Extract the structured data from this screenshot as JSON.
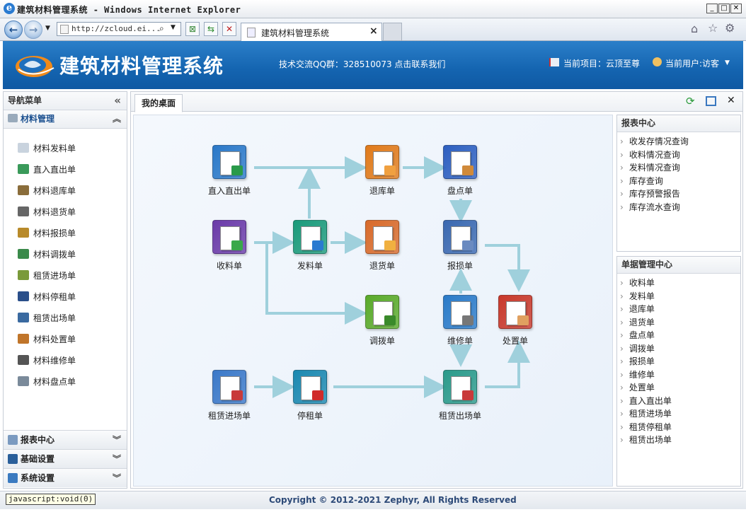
{
  "browser": {
    "window_title": "建筑材料管理系统 - Windows Internet Explorer",
    "address": "http://zcloud.ei...",
    "tab_title": "建筑材料管理系统",
    "status_text": "javascript:void(0)"
  },
  "header": {
    "app_title": "建筑材料管理系统",
    "qq_text": "技术交流QQ群：328510073 点击联系我们",
    "project_text": "当前项目：云顶至尊",
    "user_text": "当前用户:访客"
  },
  "sidebar": {
    "title": "导航菜单",
    "active_section": "材料管理",
    "items": [
      {
        "label": "材料发料单",
        "color": "#c9d3de"
      },
      {
        "label": "直入直出单",
        "color": "#3a9a5a"
      },
      {
        "label": "材料退库单",
        "color": "#8a6d3b"
      },
      {
        "label": "材料退货单",
        "color": "#666666"
      },
      {
        "label": "材料报损单",
        "color": "#b88a2a"
      },
      {
        "label": "材料调拨单",
        "color": "#3a8a4a"
      },
      {
        "label": "租赁进场单",
        "color": "#7a9a3a"
      },
      {
        "label": "材料停租单",
        "color": "#2a4f8a"
      },
      {
        "label": "租赁出场单",
        "color": "#3a6aa0"
      },
      {
        "label": "材料处置单",
        "color": "#c0752a"
      },
      {
        "label": "材料维修单",
        "color": "#555555"
      },
      {
        "label": "材料盘点单",
        "color": "#7a8a9a"
      }
    ],
    "sections": [
      {
        "label": "报表中心",
        "icon": "report-icon"
      },
      {
        "label": "基础设置",
        "icon": "settings-icon"
      },
      {
        "label": "系统设置",
        "icon": "system-icon"
      }
    ]
  },
  "desktop": {
    "tab_label": "我的桌面",
    "nodes": [
      {
        "key": "zrzc",
        "label": "直入直出单",
        "color": "#2a78c8",
        "mark": "#2a9a4a"
      },
      {
        "key": "tuiku",
        "label": "退库单",
        "color": "#e07a1a",
        "mark": "#f0a040"
      },
      {
        "key": "pandian",
        "label": "盘点单",
        "color": "#2d5fc0",
        "mark": "#d08a3a"
      },
      {
        "key": "shouliao",
        "label": "收料单",
        "color": "#6a3aa8",
        "mark": "#3aa84a"
      },
      {
        "key": "faliao",
        "label": "发料单",
        "color": "#1a9a7a",
        "mark": "#2a7ad0"
      },
      {
        "key": "tuihuo",
        "label": "退货单",
        "color": "#d86a2a",
        "mark": "#f0b040"
      },
      {
        "key": "baosun",
        "label": "报损单",
        "color": "#3a68b0",
        "mark": "#6a8ac0"
      },
      {
        "key": "diaobo",
        "label": "调拨单",
        "color": "#5aaa2a",
        "mark": "#3a8a2a"
      },
      {
        "key": "weixiu",
        "label": "维修单",
        "color": "#2a7ac8",
        "mark": "#777777"
      },
      {
        "key": "chuzhi",
        "label": "处置单",
        "color": "#c8382a",
        "mark": "#e0a060"
      },
      {
        "key": "zljc",
        "label": "租赁进场单",
        "color": "#3a78c8",
        "mark": "#c83a3a"
      },
      {
        "key": "tingzu",
        "label": "停租单",
        "color": "#1a88b0",
        "mark": "#d02a2a"
      },
      {
        "key": "zlcc",
        "label": "租赁出场单",
        "color": "#2a9a8a",
        "mark": "#c83a3a"
      }
    ]
  },
  "report_center": {
    "title": "报表中心",
    "items": [
      "收发存情况查询",
      "收料情况查询",
      "发料情况查询",
      "库存查询",
      "库存预警报告",
      "库存流水查询"
    ]
  },
  "doc_center": {
    "title": "单据管理中心",
    "items": [
      "收料单",
      "发料单",
      "退库单",
      "退货单",
      "盘点单",
      "调拨单",
      "报损单",
      "维修单",
      "处置单",
      "直入直出单",
      "租赁进场单",
      "租赁停租单",
      "租赁出场单"
    ]
  },
  "footer": {
    "copyright": "Copyright © 2012-2021 Zephyr, All Rights Reserved"
  },
  "colors": {
    "header_blue": "#1464b0",
    "arrow": "#9fd0dc",
    "footer_text": "#2d4a78"
  }
}
